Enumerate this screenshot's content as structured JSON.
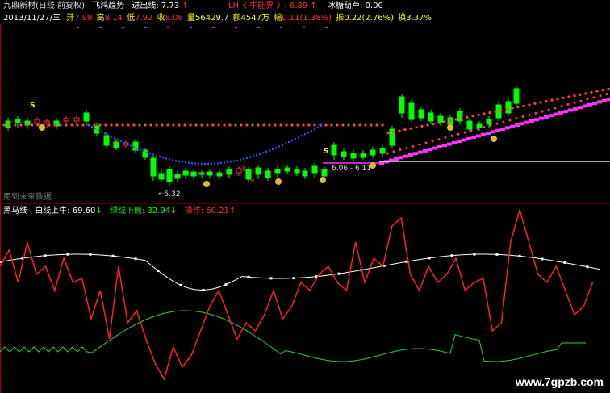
{
  "header": {
    "title": "九鼎新材(日线 前复权)",
    "indicator": "飞鸿趋势",
    "exit_label": "进出线:",
    "exit_value": "7.73",
    "lh_label": "LH《 牛能界 》:",
    "lh_value": "6.89",
    "lh_arrow": "↑",
    "bingtang": "冰糖葫芦: 0.00"
  },
  "quote": {
    "date": "2013/11/27/三",
    "open_label": "开",
    "open": "7.99",
    "high_label": "高",
    "high": "8.14",
    "low_label": "低",
    "low": "7.92",
    "close_label": "收",
    "close": "8.08",
    "vol_label": "量",
    "vol": "56429.7",
    "amt_label": "额",
    "amt": "4547万",
    "chg_label": "幅",
    "chg": "0.11(1.38%)",
    "amp_label": "振",
    "amp": "0.22(2.76%)",
    "turn_label": "换",
    "turn": "3.37%"
  },
  "annotations": {
    "low_price": "5.32",
    "range": "6.06 - 6.11",
    "unused_data": "用到未来数据",
    "watermark": "www.7gpzb.com"
  },
  "sub_indicator": {
    "name": "黑马线",
    "white_label": "白线上牛:",
    "white_value": "69.60",
    "white_arrow": "↓",
    "green_label": "绿线下熊:",
    "green_value": "32.94",
    "green_arrow": "↓",
    "op_label": "操作:",
    "op_value": "60.21",
    "op_arrow": "↑"
  },
  "colors": {
    "up": "#ff3333",
    "down": "#00ff00",
    "white_line": "#ffffff",
    "green_line": "#33cc33",
    "red_line": "#ff2222",
    "magenta": "#ff33ff",
    "blue_dots": "#3355ff",
    "label_yellow": "#ffff00"
  }
}
